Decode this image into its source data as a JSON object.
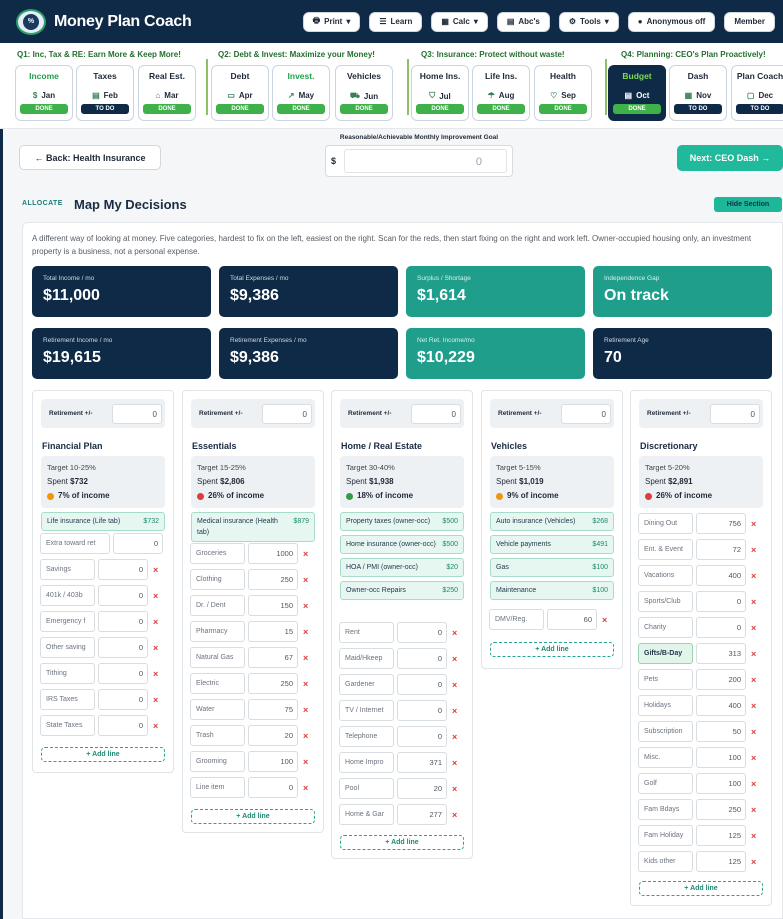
{
  "header": {
    "brand": "Money Plan Coach",
    "logo_symbol": "%",
    "nav": [
      {
        "icon": "printer-icon",
        "glyph": "🖶",
        "label": "Print",
        "caret": "▾"
      },
      {
        "icon": "list-icon",
        "glyph": "☰",
        "label": "Learn",
        "caret": ""
      },
      {
        "icon": "calculator-icon",
        "glyph": "▦",
        "label": "Calc",
        "caret": "▾"
      },
      {
        "icon": "book-icon",
        "glyph": "▤",
        "label": "Abc's",
        "caret": ""
      },
      {
        "icon": "gear-icon",
        "glyph": "⚙",
        "label": "Tools",
        "caret": "▾"
      },
      {
        "icon": "status-dot-icon",
        "glyph": "●",
        "label": "Anonymous off",
        "caret": ""
      },
      {
        "icon": "",
        "glyph": "",
        "label": "Member",
        "caret": ""
      }
    ]
  },
  "quarters": [
    {
      "q": "Q1:",
      "title": "Inc, Tax & RE: Earn More & Keep More!"
    },
    {
      "q": "Q2:",
      "title": "Debt & Invest: Maximize your Money!"
    },
    {
      "q": "Q3:",
      "title": "Insurance: Protect without waste!"
    },
    {
      "q": "Q4:",
      "title": "Planning: CEO's Plan Proactively!"
    }
  ],
  "months": [
    {
      "title": "Income",
      "month": "Jan",
      "icon": "dollar-icon",
      "glyph": "$",
      "status": "DONE"
    },
    {
      "title": "Taxes",
      "month": "Feb",
      "icon": "receipt-icon",
      "glyph": "▤",
      "status": "TO DO"
    },
    {
      "title": "Real Est.",
      "month": "Mar",
      "icon": "home-icon",
      "glyph": "⌂",
      "status": "DONE"
    },
    {
      "title": "Debt",
      "month": "Apr",
      "icon": "credit-card-icon",
      "glyph": "▭",
      "status": "DONE"
    },
    {
      "title": "Invest.",
      "month": "May",
      "icon": "trend-icon",
      "glyph": "↗",
      "status": "DONE"
    },
    {
      "title": "Vehicles",
      "month": "Jun",
      "icon": "car-icon",
      "glyph": "⛟",
      "status": "DONE"
    },
    {
      "title": "Home Ins.",
      "month": "Jul",
      "icon": "shield-icon",
      "glyph": "⛉",
      "status": "DONE"
    },
    {
      "title": "Life Ins.",
      "month": "Aug",
      "icon": "umbrella-icon",
      "glyph": "☂",
      "status": "DONE"
    },
    {
      "title": "Health",
      "month": "Sep",
      "icon": "heart-icon",
      "glyph": "♡",
      "status": "DONE"
    },
    {
      "title": "Budget",
      "month": "Oct",
      "icon": "document-icon",
      "glyph": "▤",
      "status": "DONE"
    },
    {
      "title": "Dash",
      "month": "Nov",
      "icon": "grid-icon",
      "glyph": "▦",
      "status": "TO DO"
    },
    {
      "title": "Plan Coach",
      "month": "Dec",
      "icon": "chat-icon",
      "glyph": "▢",
      "status": "TO DO"
    }
  ],
  "nav_buttons": {
    "back": "← Back: Health Insurance",
    "next": "Next: CEO Dash →"
  },
  "goal": {
    "label": "Reasonable/Achievable Monthly Improvement Goal",
    "currency": "$",
    "value": "0"
  },
  "section": {
    "eyebrow": "ALLOCATE",
    "title": "Map My Decisions",
    "hide": "Hide Section",
    "description": "A different way of looking at money. Five categories, hardest to fix on the left, easiest on the right. Scan for the reds, then start fixing on the right and work left. Owner-occupied housing only, an investment property is a business, not a personal expense."
  },
  "stats": [
    {
      "label": "Total Income / mo",
      "value": "$11,000",
      "tone": "dark"
    },
    {
      "label": "Total Expenses / mo",
      "value": "$9,386",
      "tone": "dark"
    },
    {
      "label": "Surplus / Shortage",
      "value": "$1,614",
      "tone": "teal"
    },
    {
      "label": "Independence Gap",
      "value": "On track",
      "tone": "teal"
    },
    {
      "label": "Retirement Income / mo",
      "value": "$19,615",
      "tone": "dark"
    },
    {
      "label": "Retirement Expenses / mo",
      "value": "$9,386",
      "tone": "dark"
    },
    {
      "label": "Net Ret. Income/mo",
      "value": "$10,229",
      "tone": "teal"
    },
    {
      "label": "Retirement Age",
      "value": "70",
      "tone": "dark"
    }
  ],
  "columns": [
    {
      "ret_label": "Retirement +/-",
      "ret_value": "0",
      "title": "Financial Plan",
      "target": "Target 10-25%",
      "spent_label": "Spent",
      "spent": "$732",
      "pct": "7% of income",
      "status": "or",
      "fixed": [
        {
          "name": "Life insurance (Life tab)",
          "value": "$732"
        }
      ],
      "lines": [
        {
          "name": "Extra toward ret",
          "value": "0",
          "x": false
        },
        {
          "name": "Savings",
          "value": "0",
          "x": true
        },
        {
          "name": "401k / 403b",
          "value": "0",
          "x": true
        },
        {
          "name": "Emergency f",
          "value": "0",
          "x": true
        },
        {
          "name": "Other saving",
          "value": "0",
          "x": true
        },
        {
          "name": "Tithing",
          "value": "0",
          "x": true
        },
        {
          "name": "IRS Taxes",
          "value": "0",
          "x": true
        },
        {
          "name": "State Taxes",
          "value": "0",
          "x": true
        }
      ],
      "add": "+ Add line"
    },
    {
      "ret_label": "Retirement +/-",
      "ret_value": "0",
      "title": "Essentials",
      "target": "Target 15-25%",
      "spent_label": "Spent",
      "spent": "$2,806",
      "pct": "26% of income",
      "status": "rd",
      "fixed": [
        {
          "name": "Medical insurance (Health tab)",
          "value": "$879"
        }
      ],
      "lines": [
        {
          "name": "Groceries",
          "value": "1000",
          "x": true
        },
        {
          "name": "Clothing",
          "value": "250",
          "x": true
        },
        {
          "name": "Dr. / Dent",
          "value": "150",
          "x": true
        },
        {
          "name": "Pharmacy",
          "value": "15",
          "x": true
        },
        {
          "name": "Natural Gas",
          "value": "67",
          "x": true
        },
        {
          "name": "Electric",
          "value": "250",
          "x": true
        },
        {
          "name": "Water",
          "value": "75",
          "x": true
        },
        {
          "name": "Trash",
          "value": "20",
          "x": true
        },
        {
          "name": "Grooming",
          "value": "100",
          "x": true
        },
        {
          "name": "Line item",
          "value": "0",
          "x": true
        }
      ],
      "add": "+ Add line"
    },
    {
      "ret_label": "Retirement +/-",
      "ret_value": "0",
      "title": "Home / Real Estate",
      "target": "Target 30-40%",
      "spent_label": "Spent",
      "spent": "$1,938",
      "pct": "18% of income",
      "status": "gr",
      "fixed": [
        {
          "name": "Property taxes (owner-occ)",
          "value": "$500"
        },
        {
          "name": "Home insurance (owner-occ)",
          "value": "$500"
        },
        {
          "name": "HOA / PMI (owner-occ)",
          "value": "$20"
        },
        {
          "name": "Owner-occ Repairs",
          "value": "$250"
        }
      ],
      "lines": [
        {
          "name": "Rent",
          "value": "0",
          "x": true
        },
        {
          "name": "Maid/Hkeep",
          "value": "0",
          "x": true
        },
        {
          "name": "Gardener",
          "value": "0",
          "x": true
        },
        {
          "name": "TV / Internet",
          "value": "0",
          "x": true
        },
        {
          "name": "Telephone",
          "value": "0",
          "x": true
        },
        {
          "name": "Home Impro",
          "value": "371",
          "x": true
        },
        {
          "name": "Pool",
          "value": "20",
          "x": true
        },
        {
          "name": "Home & Gar",
          "value": "277",
          "x": true
        }
      ],
      "add": "+ Add line"
    },
    {
      "ret_label": "Retirement +/-",
      "ret_value": "0",
      "title": "Vehicles",
      "target": "Target 5-15%",
      "spent_label": "Spent",
      "spent": "$1,019",
      "pct": "9% of income",
      "status": "or",
      "fixed": [
        {
          "name": "Auto insurance (Vehicles)",
          "value": "$268"
        },
        {
          "name": "Vehicle payments",
          "value": "$491"
        },
        {
          "name": "Gas",
          "value": "$100"
        },
        {
          "name": "Maintenance",
          "value": "$100"
        }
      ],
      "lines": [
        {
          "name": "DMV/Reg.",
          "value": "60",
          "x": true
        }
      ],
      "add": "+ Add line"
    },
    {
      "ret_label": "Retirement +/-",
      "ret_value": "0",
      "title": "Discretionary",
      "target": "Target 5-20%",
      "spent_label": "Spent",
      "spent": "$2,891",
      "pct": "26% of income",
      "status": "rd",
      "fixed": [],
      "lines": [
        {
          "name": "Dining Out",
          "value": "756",
          "x": true
        },
        {
          "name": "Ent. & Event",
          "value": "72",
          "x": true
        },
        {
          "name": "Vacations",
          "value": "400",
          "x": true
        },
        {
          "name": "Sports/Club",
          "value": "0",
          "x": true
        },
        {
          "name": "Charity",
          "value": "0",
          "x": true
        },
        {
          "name": "Gifts/B-Day",
          "value": "313",
          "x": true,
          "hl": true
        },
        {
          "name": "Pets",
          "value": "200",
          "x": true
        },
        {
          "name": "Holidays",
          "value": "400",
          "x": true
        },
        {
          "name": "Subscription",
          "value": "50",
          "x": true
        },
        {
          "name": "Misc.",
          "value": "100",
          "x": true
        },
        {
          "name": "Golf",
          "value": "100",
          "x": true
        },
        {
          "name": "Fam Bdays",
          "value": "250",
          "x": true
        },
        {
          "name": "Fam Holiday",
          "value": "125",
          "x": true
        },
        {
          "name": "Kids other",
          "value": "125",
          "x": true
        }
      ],
      "add": "+ Add line"
    }
  ]
}
